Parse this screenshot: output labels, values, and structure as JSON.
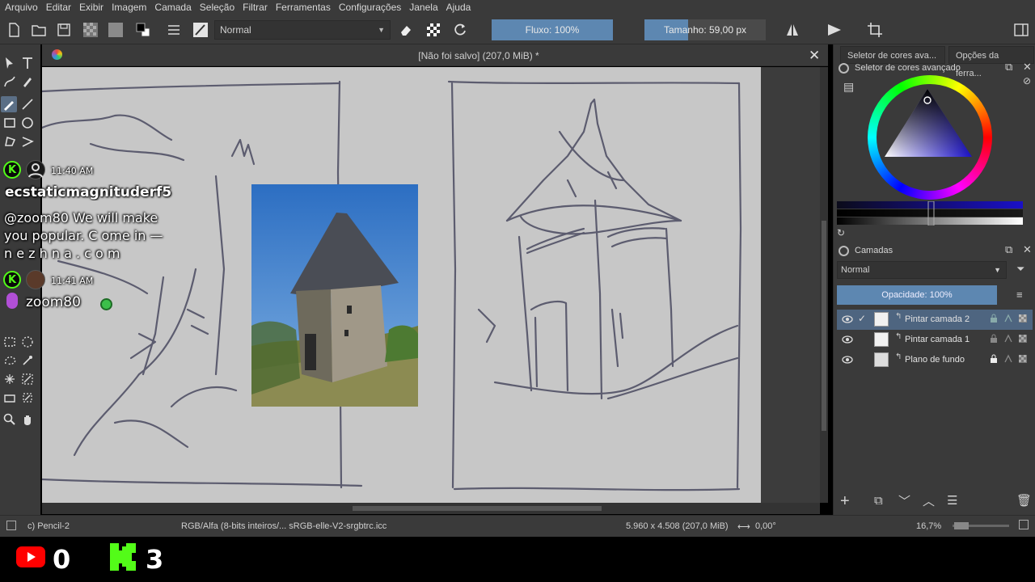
{
  "menu": [
    "Arquivo",
    "Editar",
    "Exibir",
    "Imagem",
    "Camada",
    "Seleção",
    "Filtrar",
    "Ferramentas",
    "Configurações",
    "Janela",
    "Ajuda"
  ],
  "toolbar": {
    "blend_mode": "Normal",
    "flow_label": "Fluxo: 100%",
    "size_label": "Tamanho: 59,00 px",
    "size_fill_fraction": 0.36
  },
  "document": {
    "title": "[Não foi salvo]  (207,0 MiB) *"
  },
  "dock": {
    "tabs": [
      "Seletor de cores ava...",
      "Opções da ferra..."
    ],
    "color_panel_title": "Seletor de cores avançado",
    "layers_panel_title": "Camadas",
    "layer_blend_mode": "Normal",
    "opacity_label": "Opacidade:  100%",
    "layers": [
      {
        "name": "Pintar camada 2",
        "active": true
      },
      {
        "name": "Pintar camada 1",
        "active": false
      },
      {
        "name": "Plano de fundo",
        "active": false
      }
    ]
  },
  "status": {
    "brush": "c) Pencil-2",
    "color_space": "RGB/Alfa (8-bits inteiros/...  sRGB-elle-V2-srgbtrc.icc",
    "dimensions": "5.960 x 4.508 (207,0 MiB)",
    "rotation": "0,00°",
    "zoom": "16,7%"
  },
  "chat": [
    {
      "time": "11:40 AM",
      "user": "ecstaticmagnituderf5",
      "message_lines": [
        "@zoom80 We will make",
        "you popular. C ome in —",
        "n e z h n a . c o m"
      ]
    },
    {
      "time": "11:41 AM",
      "user": "zoom80"
    }
  ],
  "stream": {
    "youtube_count": "0",
    "kick_count": "3"
  },
  "colors": {
    "accent": "#5d87b1",
    "panel": "#3a3a3a",
    "paper": "#c7c7c7",
    "kick_green": "#53fc18"
  }
}
